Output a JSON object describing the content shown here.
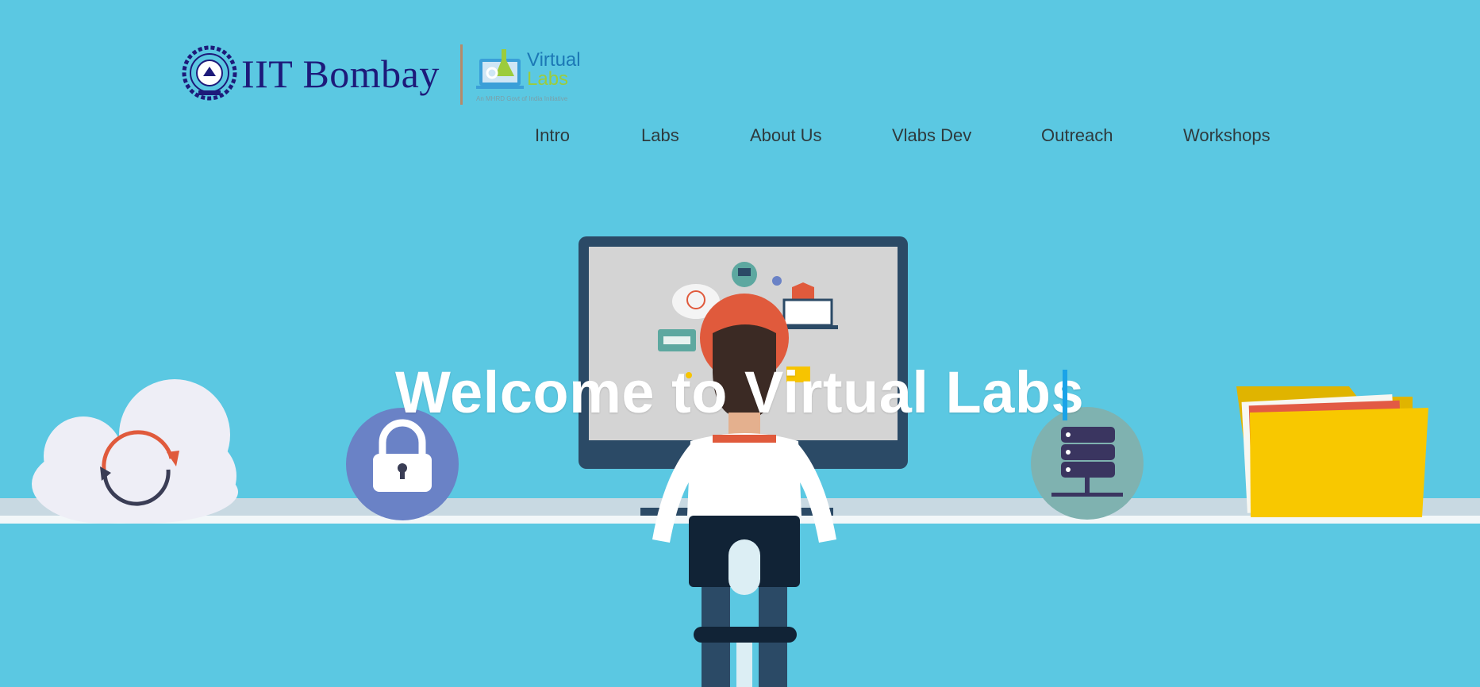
{
  "brand": {
    "institute_name": "IIT Bombay",
    "vlabs_line1": "Virtual",
    "vlabs_line2": "Labs",
    "vlabs_tagline": "An MHRD Govt of India Initiative"
  },
  "nav": {
    "items": [
      {
        "label": "Intro"
      },
      {
        "label": "Labs"
      },
      {
        "label": "About Us"
      },
      {
        "label": "Vlabs Dev"
      },
      {
        "label": "Outreach"
      },
      {
        "label": "Workshops"
      }
    ]
  },
  "hero": {
    "title": "Welcome to Virtual Labs"
  },
  "colors": {
    "background": "#5bc8e2",
    "accent_cursor": "#1aa3e8",
    "brand_navy": "#1d1a7a"
  }
}
